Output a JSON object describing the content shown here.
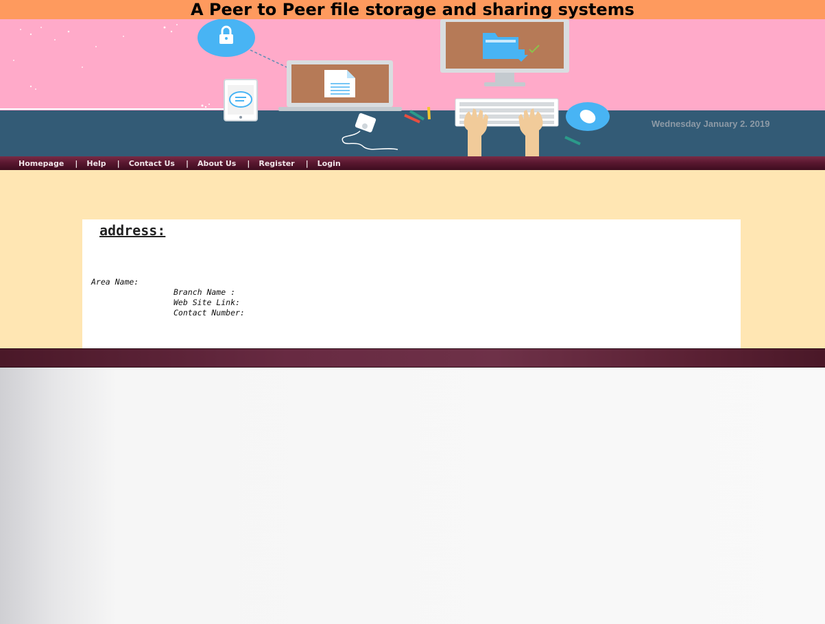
{
  "page": {
    "title": "A Peer to Peer file storage and sharing systems"
  },
  "banner": {
    "date": "Wednesday January 2. 2019"
  },
  "nav": {
    "items": [
      {
        "label": "Homepage"
      },
      {
        "label": "Help"
      },
      {
        "label": "Contact Us"
      },
      {
        "label": "About Us"
      },
      {
        "label": "Register"
      },
      {
        "label": "Login"
      }
    ],
    "separator": "|"
  },
  "address": {
    "heading": "address:",
    "area_name_label": "Area Name:",
    "branch_name_label": "Branch Name :",
    "web_site_link_label": "Web Site Link:",
    "contact_number_label": "Contact Number:"
  },
  "colors": {
    "title_bar": "#fe9a5e",
    "banner_sky": "#ffaac9",
    "banner_desk": "#335b76",
    "nav_bar": "#5a1830",
    "content_bg": "#ffe6b3",
    "footer_bar": "#682a42"
  }
}
